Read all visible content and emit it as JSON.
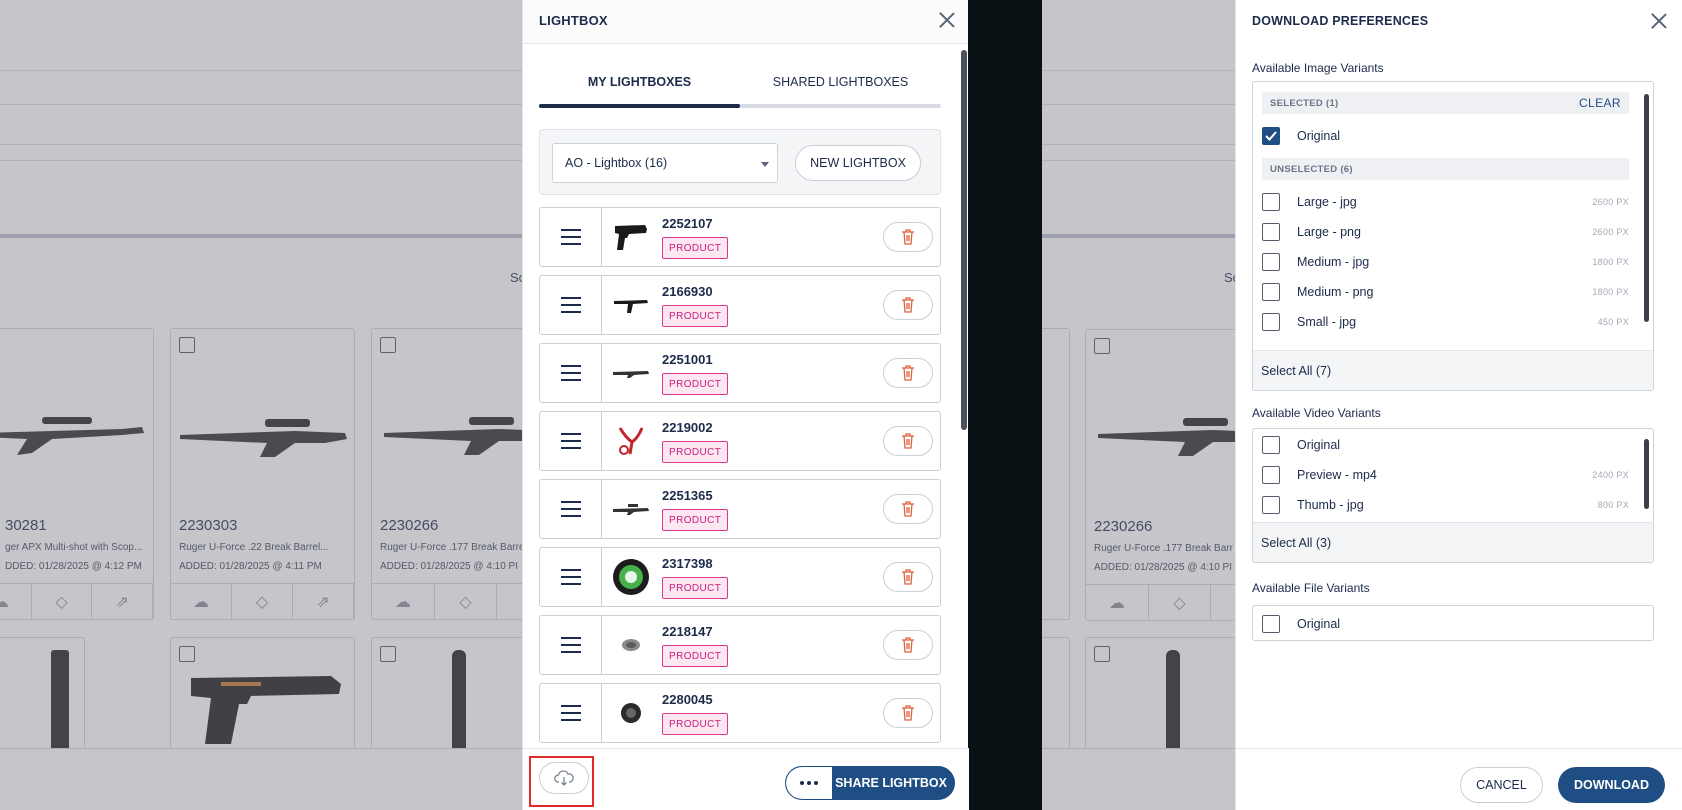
{
  "background": {
    "left_cards": [
      {
        "title": "30281",
        "desc": "ger APX Multi-shot with Scop...",
        "added": "DDED: 01/28/2025 @ 4:12 PM"
      },
      {
        "title": "2230303",
        "desc": "Ruger U-Force .22 Break Barrel...",
        "added": "ADDED: 01/28/2025 @ 4:11 PM"
      },
      {
        "title": "2230266",
        "desc": "Ruger U-Force .177 Break Barre",
        "added": "ADDED: 01/28/2025 @ 4:10 PI"
      }
    ],
    "right_card": {
      "title": "2230266",
      "desc": "Ruger U-Force .177 Break Barr",
      "added": "ADDED: 01/28/2025 @ 4:10 PI"
    },
    "left_stub": "Sc",
    "right_stub": "Sc"
  },
  "lightbox": {
    "title": "LIGHTBOX",
    "tabs": [
      {
        "label": "MY LIGHTBOXES",
        "active": true
      },
      {
        "label": "SHARED LIGHTBOXES",
        "active": false
      }
    ],
    "selected_lightbox": "AO - Lightbox (16)",
    "new_lightbox_label": "NEW LIGHTBOX",
    "items": [
      {
        "id": "2252107",
        "badge": "PRODUCT",
        "thumb": "pistol"
      },
      {
        "id": "2166930",
        "badge": "PRODUCT",
        "thumb": "longpistol"
      },
      {
        "id": "2251001",
        "badge": "PRODUCT",
        "thumb": "rifle"
      },
      {
        "id": "2219002",
        "badge": "PRODUCT",
        "thumb": "slingshot"
      },
      {
        "id": "2251365",
        "badge": "PRODUCT",
        "thumb": "scoped-rifle"
      },
      {
        "id": "2317398",
        "badge": "PRODUCT",
        "thumb": "tin"
      },
      {
        "id": "2218147",
        "badge": "PRODUCT",
        "thumb": "pellet"
      },
      {
        "id": "2280045",
        "badge": "PRODUCT",
        "thumb": "cylinder"
      }
    ],
    "share_label": "SHARE LIGHTBOX"
  },
  "prefs": {
    "title": "DOWNLOAD PREFERENCES",
    "image_section_label": "Available Image Variants",
    "selected_header": "SELECTED (1)",
    "clear_label": "CLEAR",
    "selected_items": [
      {
        "name": "Original",
        "size": ""
      }
    ],
    "unselected_header": "UNSELECTED (6)",
    "unselected_items": [
      {
        "name": "Large - jpg",
        "size": "2600 PX"
      },
      {
        "name": "Large - png",
        "size": "2600 PX"
      },
      {
        "name": "Medium - jpg",
        "size": "1800 PX"
      },
      {
        "name": "Medium - png",
        "size": "1800 PX"
      },
      {
        "name": "Small - jpg",
        "size": "450 PX"
      }
    ],
    "image_select_all": "Select All (7)",
    "video_section_label": "Available Video Variants",
    "video_items": [
      {
        "name": "Original",
        "size": ""
      },
      {
        "name": "Preview - mp4",
        "size": "2400 PX"
      },
      {
        "name": "Thumb - jpg",
        "size": "800 PX"
      }
    ],
    "video_select_all": "Select All (3)",
    "file_section_label": "Available File Variants",
    "file_items": [
      {
        "name": "Original",
        "size": ""
      }
    ],
    "cancel_label": "CANCEL",
    "download_label": "DOWNLOAD"
  },
  "colors": {
    "navy": "#1c2b4a",
    "primary_button": "#1f4e85",
    "badge_pink": "#e0388a",
    "trash_red": "#e0603c",
    "highlight_red": "#e02b2b"
  }
}
